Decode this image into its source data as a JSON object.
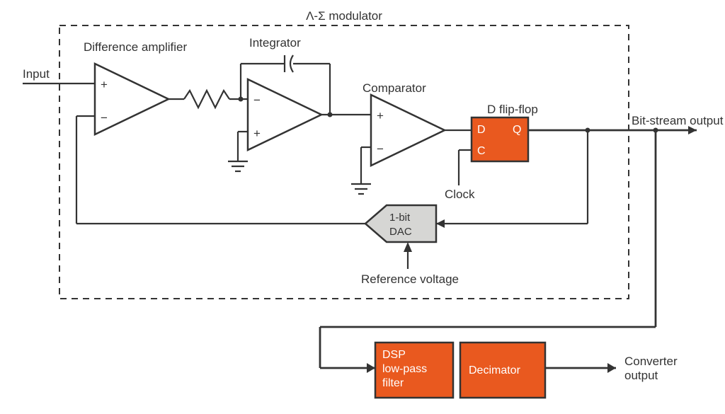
{
  "title": "Λ-Σ modulator",
  "labels": {
    "input": "Input",
    "diff_amp": "Difference amplifier",
    "integrator": "Integrator",
    "comparator": "Comparator",
    "flipflop": "D flip-flop",
    "bitstream": "Bit-stream output",
    "dac_line1": "1-bit",
    "dac_line2": "DAC",
    "ref_voltage": "Reference voltage",
    "clock": "Clock",
    "dsp_line1": "DSP",
    "dsp_line2": "low-pass",
    "dsp_line3": "filter",
    "decimator": "Decimator",
    "conv_line1": "Converter",
    "conv_line2": "output",
    "ff_d": "D",
    "ff_q": "Q",
    "ff_c": "C",
    "plus": "+",
    "minus": "−"
  }
}
